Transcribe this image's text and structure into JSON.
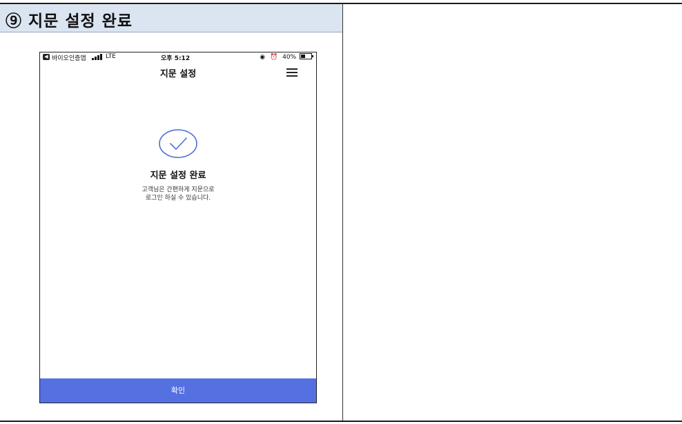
{
  "document": {
    "section_title": "⑨ 지문 설정 완료"
  },
  "phone": {
    "status_bar": {
      "back_app": "바이오인증앱",
      "network": "LTE",
      "time": "오후 5:12",
      "battery": "40%"
    },
    "header": {
      "title": "지문 설정",
      "menu_icon": "hamburger-menu-icon"
    },
    "content": {
      "icon": "check-circle-icon",
      "title": "지문 설정 완료",
      "description_line1": "고객님은 간편하게 지문으로",
      "description_line2": "로그인 하실 수 있습니다."
    },
    "confirm_button": "확인"
  },
  "colors": {
    "header_cell_bg": "#dbe5f1",
    "button_bg": "#5570e0",
    "check_stroke": "#4a6fd6"
  }
}
